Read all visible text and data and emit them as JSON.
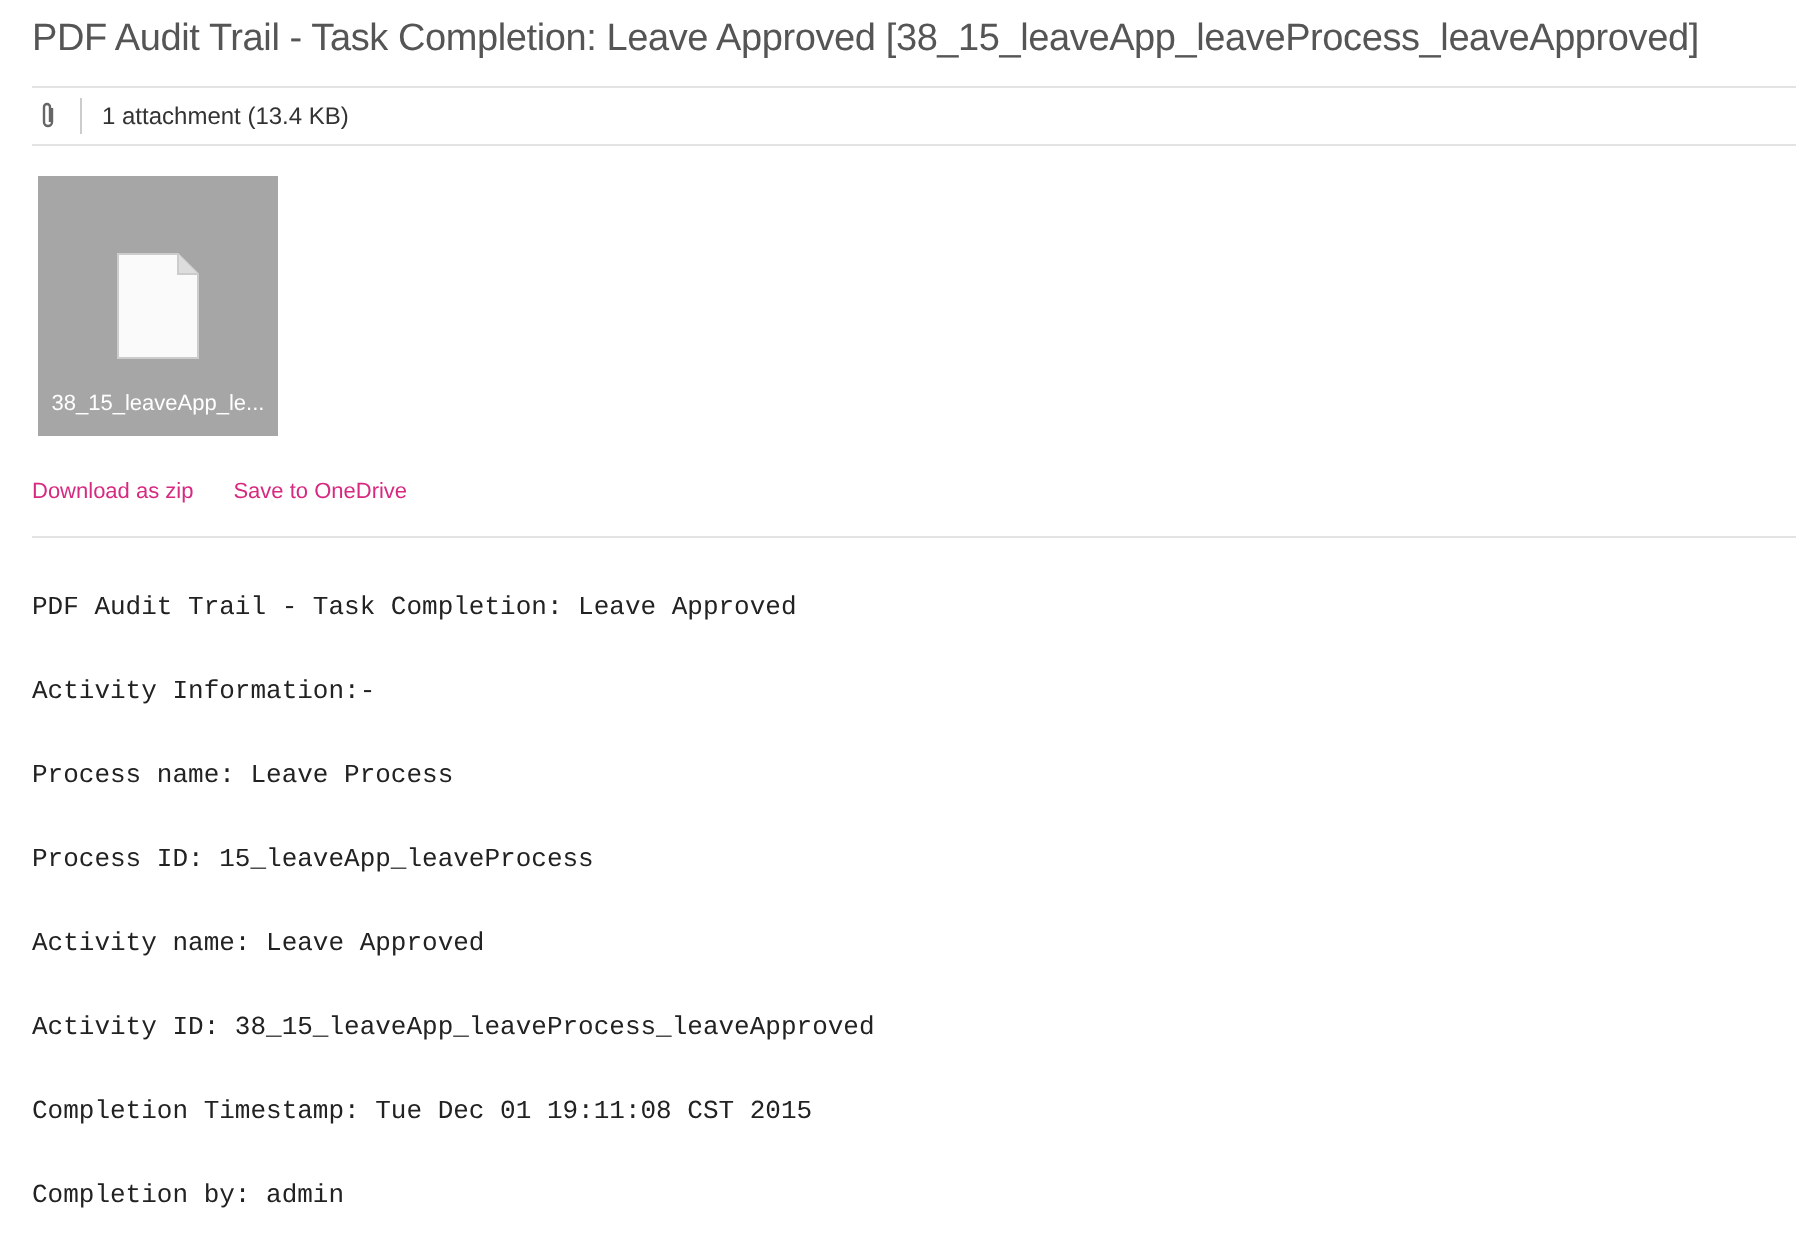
{
  "title": "PDF Audit Trail - Task Completion: Leave Approved [38_15_leaveApp_leaveProcess_leaveApproved]",
  "attachments": {
    "summary": "1 attachment (13.4 KB)",
    "files": [
      {
        "name": "38_15_leaveApp_le..."
      }
    ],
    "actions": [
      "Download as zip",
      "Save to OneDrive"
    ]
  },
  "body": [
    "PDF Audit Trail - Task Completion: Leave Approved",
    "Activity Information:-",
    "Process name: Leave Process",
    "Process ID: 15_leaveApp_leaveProcess",
    "Activity name: Leave Approved",
    "Activity ID: 38_15_leaveApp_leaveProcess_leaveApproved",
    "Completion Timestamp: Tue Dec 01 19:11:08 CST 2015",
    "Completion by: admin"
  ]
}
